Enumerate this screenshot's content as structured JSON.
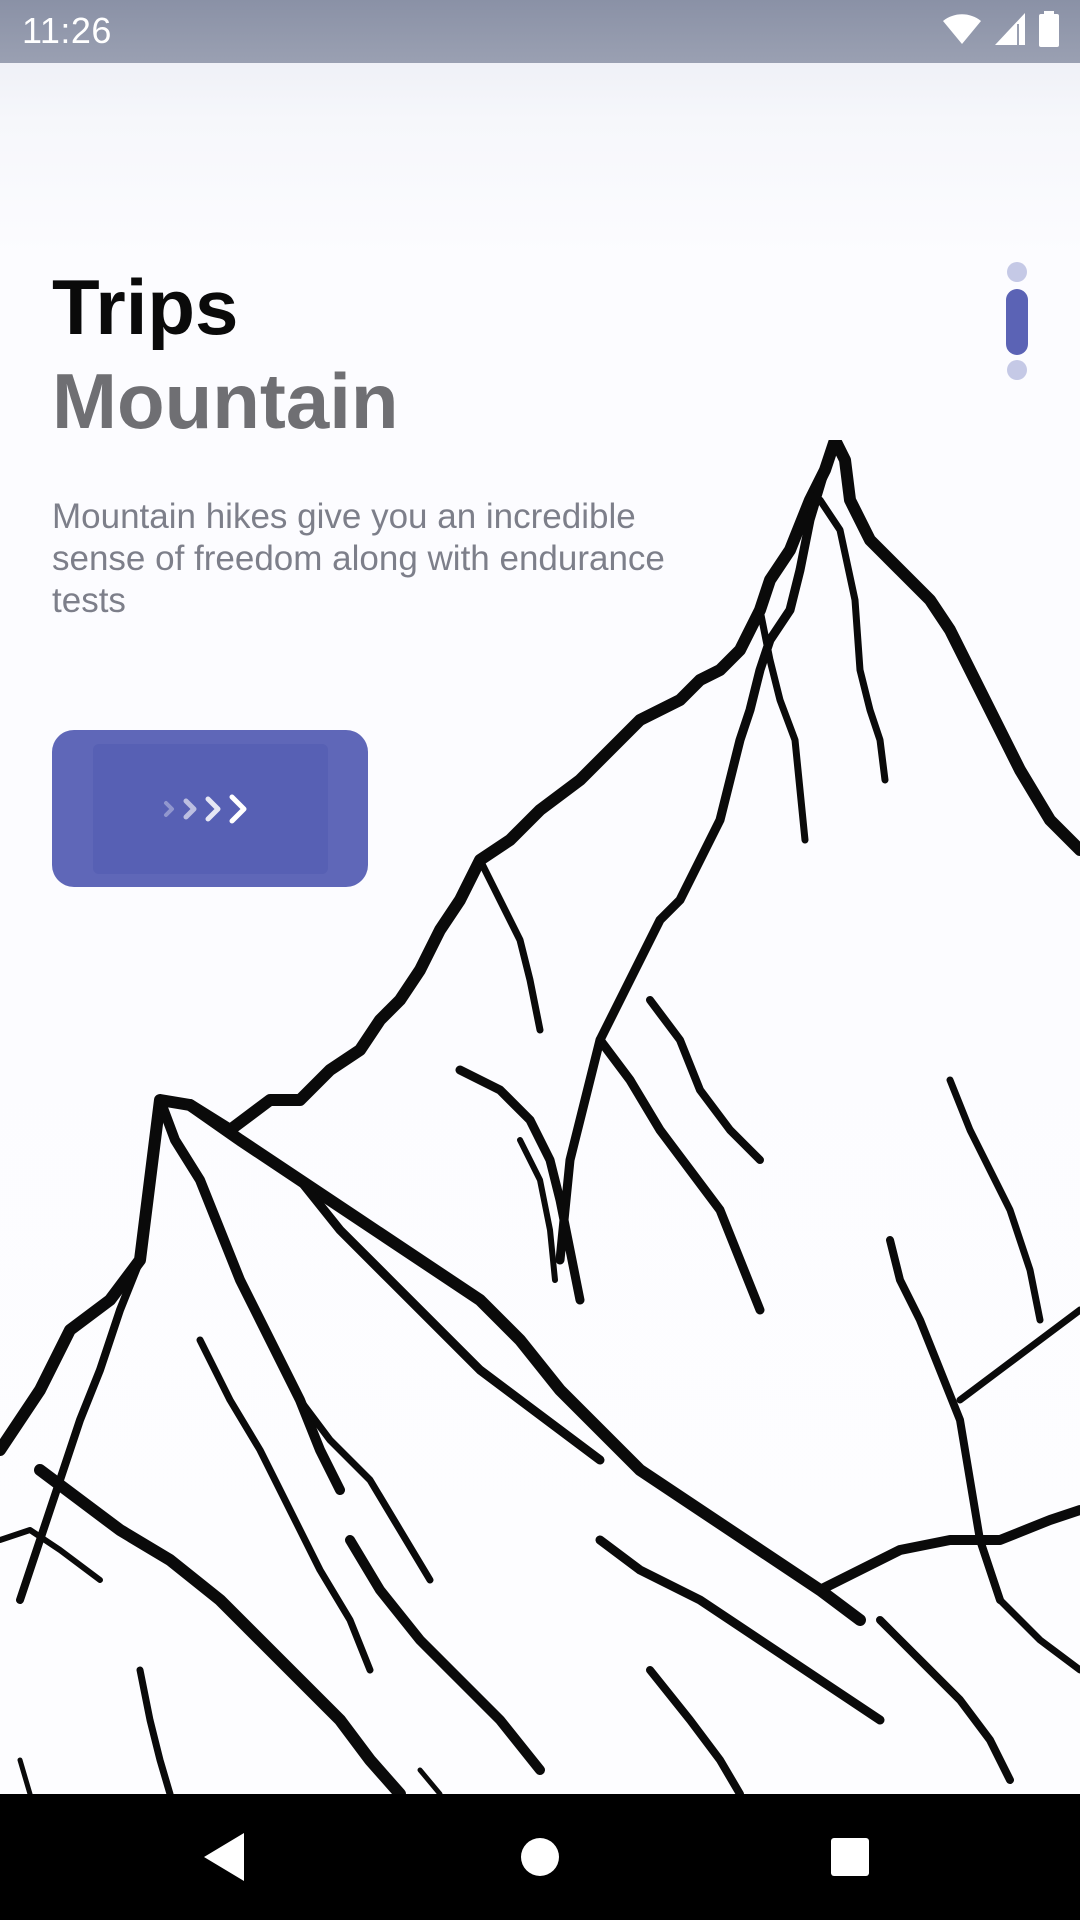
{
  "status_bar": {
    "time": "11:26",
    "icons": [
      "wifi-icon",
      "cellular-signal-icon",
      "battery-icon"
    ]
  },
  "content": {
    "title": "Trips",
    "subtitle": "Mountain",
    "description": "Mountain hikes give you an incredible sense of freedom along with endurance tests",
    "next_button_icon": "chevrons-right-icon"
  },
  "page_indicator": {
    "count": 3,
    "active_index": 1
  },
  "illustration": "mountain-sketch",
  "nav_bar": {
    "buttons": [
      "back-icon",
      "home-icon",
      "recents-icon"
    ]
  },
  "colors": {
    "accent": "#5f67b8",
    "indicator_active": "#5b63b5",
    "indicator_inactive": "#c5c9e6",
    "title": "#0a0a0a",
    "subtitle": "#6f6f73",
    "description": "#7d7f8a"
  }
}
